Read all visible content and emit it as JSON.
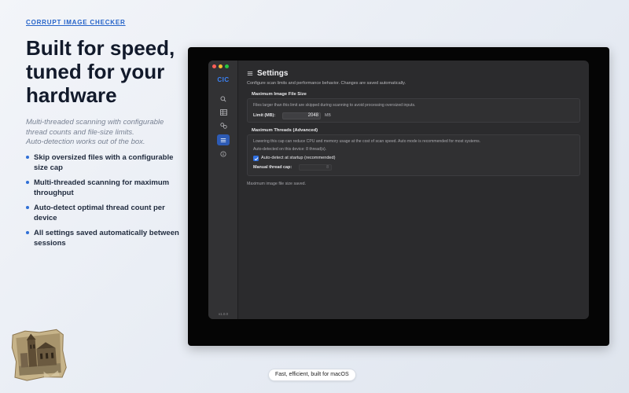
{
  "marketing": {
    "eyebrow": "CORRUPT IMAGE CHECKER",
    "headline_lines": [
      "Built for speed,",
      "tuned for your",
      "hardware"
    ],
    "subtext_lines": [
      "Multi-threaded scanning with configurable",
      "thread counts and file-size limits.",
      "Auto-detection works out of the box."
    ],
    "features": [
      "Skip oversized files with a configurable size cap",
      "Multi-threaded scanning for maximum throughput",
      "Auto-detect optimal thread count per device",
      "All settings saved automatically between sessions"
    ],
    "footer_pill": "Fast, efficient, built for macOS"
  },
  "app": {
    "logo": "CIC",
    "version": "v1.0.0",
    "nav": [
      {
        "icon": "search-icon",
        "active": false
      },
      {
        "icon": "table-icon",
        "active": false
      },
      {
        "icon": "link-icon",
        "active": false
      },
      {
        "icon": "settings-list-icon",
        "active": true
      },
      {
        "icon": "info-icon",
        "active": false
      }
    ],
    "settings": {
      "title": "Settings",
      "description": "Configure scan limits and performance behavior. Changes are saved automatically.",
      "file_size": {
        "section_title": "Maximum Image File Size",
        "help": "Files larger than this limit are skipped during scanning to avoid processing oversized inputs.",
        "limit_label": "Limit (MB):",
        "limit_value": "2048",
        "unit": "MB"
      },
      "threads": {
        "section_title": "Maximum Threads (Advanced)",
        "help": "Lowering this cap can reduce CPU and memory usage at the cost of scan speed. Auto mode is recommended for most systems.",
        "auto_detected": "Auto-detected on this device: 8 thread(s).",
        "auto_checkbox_label": "Auto-detect at startup (recommended)",
        "auto_checked": true,
        "manual_label": "Manual thread cap:",
        "manual_value": "8"
      },
      "status": "Maximum image file size saved."
    }
  },
  "colors": {
    "accent": "#2f6fe0",
    "window_bg": "#2b2b2d",
    "sidebar_bg": "#323234",
    "headline": "#121a2b"
  }
}
